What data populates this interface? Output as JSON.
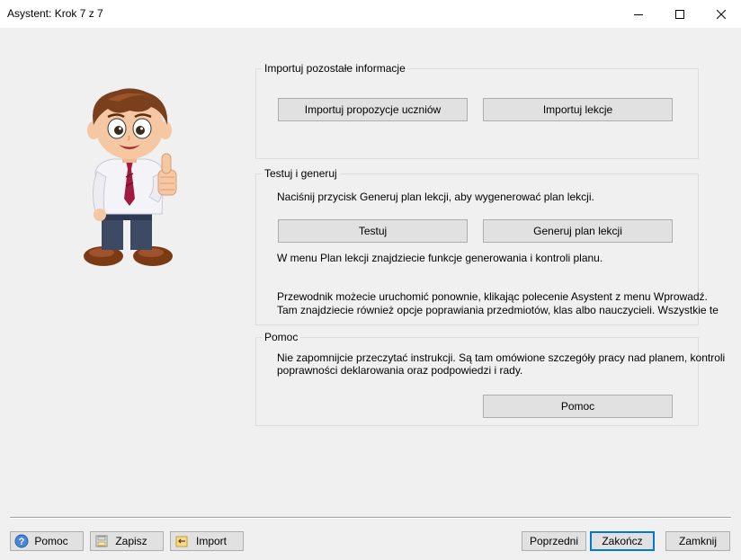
{
  "window": {
    "title": "Asystent: Krok 7 z 7"
  },
  "mascot": {
    "icon": "mascot-boy-thumbs-up-icon"
  },
  "group_import": {
    "title": "Importuj pozostałe informacje",
    "import_proposals_label": "Importuj propozycje uczniów",
    "import_lessons_label": "Importuj lekcje"
  },
  "group_generate": {
    "title": "Testuj i generuj",
    "instruction": "Naciśnij przycisk Generuj plan lekcji, aby wygenerować plan lekcji.",
    "test_label": "Testuj",
    "generate_label": "Generuj plan lekcji",
    "menu_info": "W menu Plan lekcji znajdziecie funkcje generowania i kontroli planu.",
    "wizard_info_line1": "Przewodnik możecie uruchomić ponownie, klikając polecenie Asystent z menu Wprowadź.",
    "wizard_info_line2": "Tam znajdziecie również opcje poprawiania przedmiotów, klas albo nauczycieli. Wszystkie te"
  },
  "group_help": {
    "title": "Pomoc",
    "text_line1": "Nie zapomnijcie przeczytać instrukcji. Są tam omówione szczegóły pracy nad planem, kontroli",
    "text_line2": "poprawności deklarowania oraz podpowiedzi i rady.",
    "help_label": "Pomoc"
  },
  "footer": {
    "help_label": "Pomoc",
    "save_label": "Zapisz",
    "import_label": "Import",
    "previous_label": "Poprzedni",
    "finish_label": "Zakończ",
    "close_label": "Zamknij"
  },
  "colors": {
    "accent": "#0078d7",
    "button_bg": "#e1e1e1",
    "background": "#f0f0f0"
  }
}
